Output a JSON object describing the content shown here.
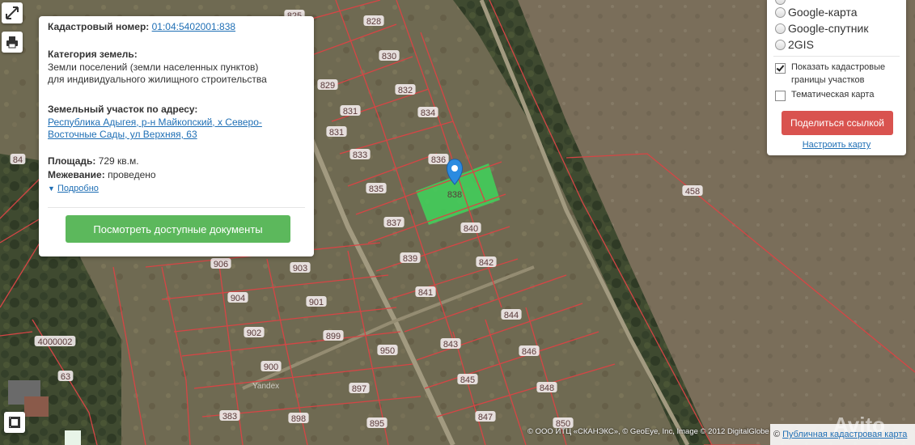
{
  "tools": {
    "fullscreen_icon": "expand-arrows-icon",
    "print_icon": "printer-icon",
    "legend_icon": "film-legend-icon"
  },
  "info": {
    "cadastral_label": "Кадастровый номер:",
    "cadastral_number": "01:04:5402001:838",
    "category_label": "Категория земель:",
    "category_value_line1": "Земли поселений (земли населенных пунктов)",
    "category_value_line2": "для индивидуального жилищного строительства",
    "address_label": "Земельный участок по адресу:",
    "address_line1": "Республика Адыгея, р-н Майкопский, х Северо-",
    "address_line2": "Восточные Сады, ул Верхняя, 63",
    "area_label": "Площадь:",
    "area_value": "729 кв.м.",
    "survey_label": "Межевание:",
    "survey_value": "проведено",
    "details_link": "Подробно",
    "docs_button": "Посмотреть доступные документы"
  },
  "layers": {
    "options": [
      "Google-карта",
      "Google-спутник",
      "2GIS"
    ],
    "checkbox_boundaries_line1": "Показать кадастровые",
    "checkbox_boundaries_line2": "границы участков",
    "checkbox_boundaries_checked": true,
    "checkbox_thematic": "Тематическая карта",
    "checkbox_thematic_checked": false,
    "share_button": "Поделиться ссылкой",
    "setup_link": "Настроить карту"
  },
  "map": {
    "selected_plot": "838",
    "plot_labels": [
      "825",
      "828",
      "830",
      "829",
      "832",
      "831",
      "834",
      "831",
      "833",
      "836",
      "835",
      "837",
      "840",
      "839",
      "842",
      "841",
      "844",
      "843",
      "846",
      "845",
      "848",
      "847",
      "850",
      "906",
      "903",
      "904",
      "901",
      "902",
      "899",
      "900",
      "897",
      "898",
      "895",
      "950",
      "458",
      "84",
      "4000002",
      "63",
      "383"
    ],
    "yandex": "Yandex",
    "watermark": "Avito"
  },
  "footer": {
    "attribution": "© ООО ИТЦ «СКАНЭКС», © GeoEye, Inc, Image © 2012 DigitalGlobe",
    "pkk_link": "Публичная кадастровая карта"
  },
  "colors": {
    "selected_fill": "#3fd35a",
    "boundary": "#d64545",
    "docs_button": "#5cb85c",
    "share_button": "#d9534f",
    "link": "#1f6fb5"
  }
}
